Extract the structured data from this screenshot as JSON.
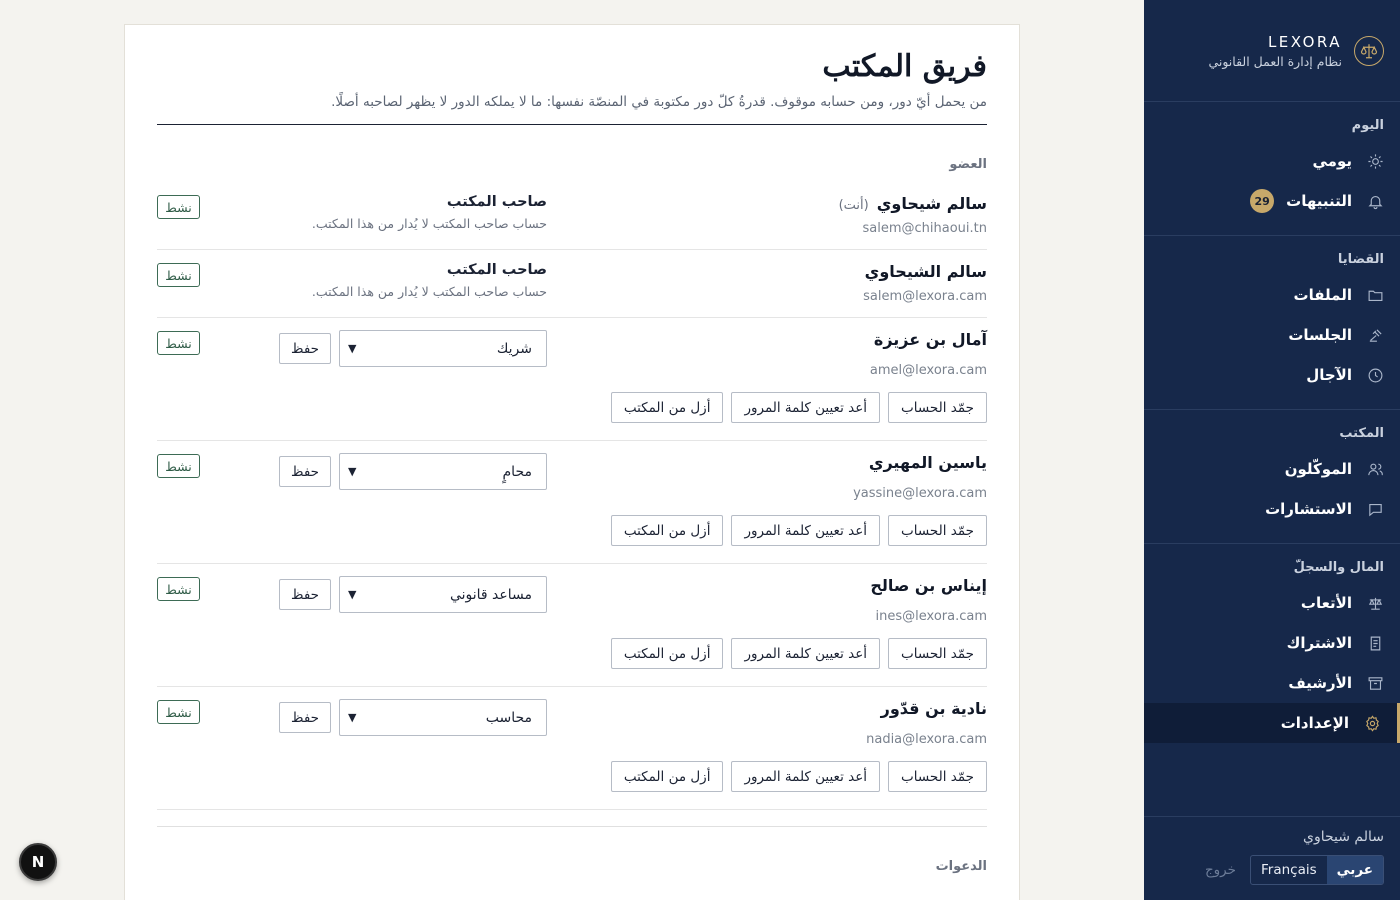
{
  "sidebar": {
    "brand": "LEXORA",
    "tagline": "نظام إدارة العمل القانوني",
    "sections": [
      {
        "title": "اليوم",
        "items": [
          {
            "label": "يومي",
            "icon": "sun-icon"
          },
          {
            "label": "التنبيهات",
            "icon": "bell-icon",
            "badge": "29"
          }
        ]
      },
      {
        "title": "القضايا",
        "items": [
          {
            "label": "الملفات",
            "icon": "folder-icon"
          },
          {
            "label": "الجلسات",
            "icon": "gavel-icon"
          },
          {
            "label": "الآجال",
            "icon": "clock-icon"
          }
        ]
      },
      {
        "title": "المكتب",
        "items": [
          {
            "label": "الموكّلون",
            "icon": "users-icon"
          },
          {
            "label": "الاستشارات",
            "icon": "chat-icon"
          }
        ]
      },
      {
        "title": "المال والسجلّ",
        "items": [
          {
            "label": "الأتعاب",
            "icon": "scales-icon"
          },
          {
            "label": "الاشتراك",
            "icon": "receipt-icon"
          },
          {
            "label": "الأرشيف",
            "icon": "archive-icon"
          },
          {
            "label": "الإعدادات",
            "icon": "gear-icon",
            "active": true
          }
        ]
      }
    ],
    "user_name": "سالم شيحاوي",
    "lang_ar": "عربي",
    "lang_fr": "Français",
    "logout": "خروج"
  },
  "main": {
    "title": "فريق المكتب",
    "subtitle": "من يحمل أيّ دور، ومن حسابه موقوف. قدرةُ كلّ دور مكتوبة في المنصّة نفسها: ما لا يملكه الدور لا يظهر لصاحبه أصلًا.",
    "member_header": "العضو",
    "invites_header": "الدعوات",
    "save_label": "حفظ",
    "status_label": "نشط",
    "you_label": "(أنت)",
    "actions": {
      "freeze": "جمّد الحساب",
      "reset": "أعد تعيين كلمة المرور",
      "remove": "أزل من المكتب"
    },
    "members": [
      {
        "name": "سالم شيحاوي",
        "you": true,
        "email": "salem@chihaoui.tn",
        "owner": true,
        "role": "صاحب المكتب",
        "owner_note": "حساب صاحب المكتب لا يُدار من هذا المكتب."
      },
      {
        "name": "سالم الشيحاوي",
        "email": "salem@lexora.cam",
        "owner": true,
        "role": "صاحب المكتب",
        "owner_note": "حساب صاحب المكتب لا يُدار من هذا المكتب."
      },
      {
        "name": "آمال بن عزيزة",
        "email": "amel@lexora.cam",
        "role": "شريك"
      },
      {
        "name": "ياسين المهيري",
        "email": "yassine@lexora.cam",
        "role": "محامٍ"
      },
      {
        "name": "إيناس بن صالح",
        "email": "ines@lexora.cam",
        "role": "مساعد قانوني"
      },
      {
        "name": "نادية بن قدّور",
        "email": "nadia@lexora.cam",
        "role": "محاسب"
      }
    ]
  },
  "colors": {
    "sidebar_bg": "#16284a",
    "accent_gold": "#c7a86a",
    "status_green": "#2f5c47"
  },
  "fab_label": "N"
}
